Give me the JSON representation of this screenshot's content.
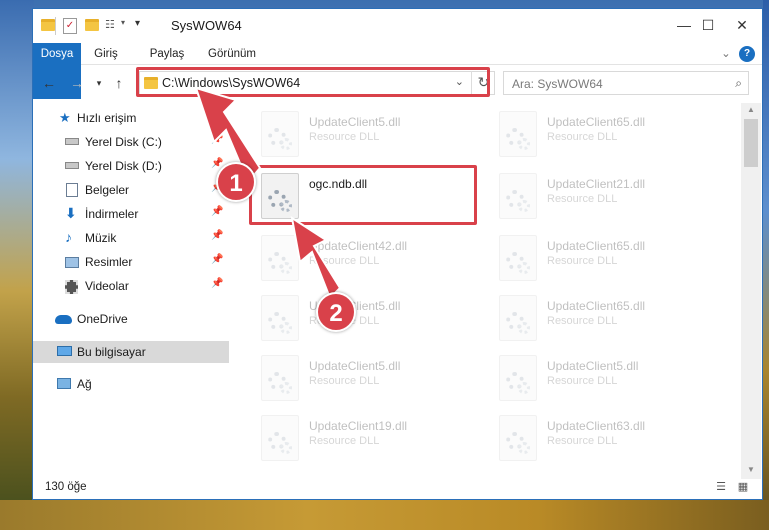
{
  "window": {
    "title": "SysWOW64",
    "minimize": "—",
    "maximize": "☐",
    "close": "✕"
  },
  "ribbon": {
    "tabs": [
      "Dosya",
      "Giriş",
      "Paylaş",
      "Görünüm"
    ],
    "expand": "⌄",
    "help": "?"
  },
  "address": {
    "path": "C:\\Windows\\SysWOW64",
    "dropdown": "⌄",
    "refresh": "↻"
  },
  "search": {
    "placeholder": "Ara: SysWOW64",
    "icon": "⌕"
  },
  "navigation": {
    "items": [
      {
        "label": "Hızlı erişim",
        "icon": "star-icon"
      },
      {
        "label": "Yerel Disk (C:)",
        "icon": "drive-icon",
        "pinned": true
      },
      {
        "label": "Yerel Disk (D:)",
        "icon": "drive-icon",
        "pinned": true
      },
      {
        "label": "Belgeler",
        "icon": "document-icon",
        "pinned": true
      },
      {
        "label": "İndirmeler",
        "icon": "download-icon",
        "pinned": true
      },
      {
        "label": "Müzik",
        "icon": "music-icon",
        "pinned": true
      },
      {
        "label": "Resimler",
        "icon": "picture-icon",
        "pinned": true
      },
      {
        "label": "Videolar",
        "icon": "video-icon",
        "pinned": true
      },
      {
        "label": "OneDrive",
        "icon": "cloud-icon"
      },
      {
        "label": "Bu bilgisayar",
        "icon": "computer-icon",
        "selected": true
      },
      {
        "label": "Ağ",
        "icon": "network-icon"
      }
    ]
  },
  "files": {
    "left": [
      {
        "name": "UpdateClient5.dll",
        "desc": "Resource DLL"
      },
      {
        "name": "ogc.ndb.dll",
        "desc": ""
      },
      {
        "name": "UpdateClient42.dll",
        "desc": "Resource DLL"
      },
      {
        "name": "UpdateClient5.dll",
        "desc": "Resource DLL"
      },
      {
        "name": "UpdateClient5.dll",
        "desc": "Resource DLL"
      },
      {
        "name": "UpdateClient19.dll",
        "desc": "Resource DLL"
      }
    ],
    "right": [
      {
        "name": "UpdateClient65.dll",
        "desc": "Resource DLL"
      },
      {
        "name": "UpdateClient21.dll",
        "desc": "Resource DLL"
      },
      {
        "name": "UpdateClient65.dll",
        "desc": "Resource DLL"
      },
      {
        "name": "UpdateClient65.dll",
        "desc": "Resource DLL"
      },
      {
        "name": "UpdateClient5.dll",
        "desc": "Resource DLL"
      },
      {
        "name": "UpdateClient63.dll",
        "desc": "Resource DLL"
      }
    ]
  },
  "status": {
    "count": "130 öğe"
  },
  "callouts": {
    "one": "1",
    "two": "2"
  },
  "colors": {
    "accent": "#1a6fc1",
    "highlight": "#d9414a"
  }
}
